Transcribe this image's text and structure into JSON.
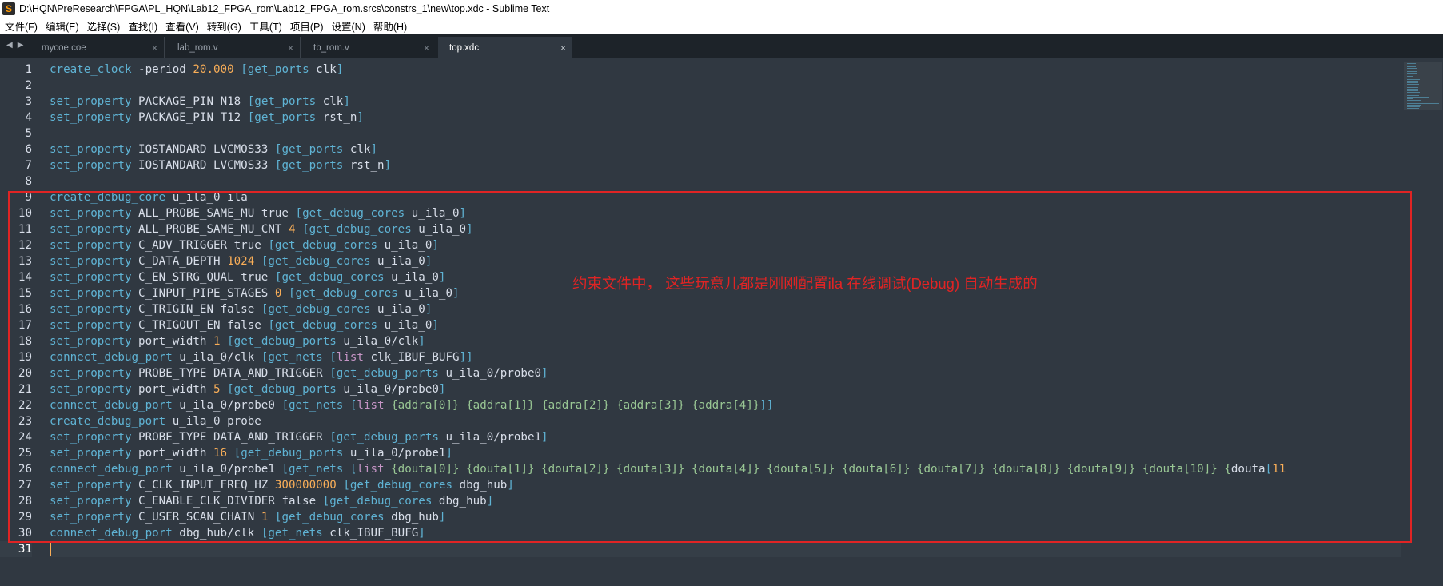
{
  "window": {
    "title": "D:\\HQN\\PreResearch\\FPGA\\PL_HQN\\Lab12_FPGA_rom\\Lab12_FPGA_rom.srcs\\constrs_1\\new\\top.xdc - Sublime Text",
    "app_icon_glyph": "S"
  },
  "menu": [
    "文件(F)",
    "编辑(E)",
    "选择(S)",
    "查找(I)",
    "查看(V)",
    "转到(G)",
    "工具(T)",
    "项目(P)",
    "设置(N)",
    "帮助(H)"
  ],
  "tabs": [
    {
      "label": "mycoe.coe",
      "active": false
    },
    {
      "label": "lab_rom.v",
      "active": false
    },
    {
      "label": "tb_rom.v",
      "active": false
    },
    {
      "label": "top.xdc",
      "active": true
    }
  ],
  "tab_close_glyph": "×",
  "nav": {
    "back": "◀",
    "forward": "▶"
  },
  "editor": {
    "current_line": 31,
    "lines": [
      "create_clock -period 20.000 [get_ports clk]",
      "",
      "set_property PACKAGE_PIN N18 [get_ports clk]",
      "set_property PACKAGE_PIN T12 [get_ports rst_n]",
      "",
      "set_property IOSTANDARD LVCMOS33 [get_ports clk]",
      "set_property IOSTANDARD LVCMOS33 [get_ports rst_n]",
      "",
      "create_debug_core u_ila_0 ila",
      "set_property ALL_PROBE_SAME_MU true [get_debug_cores u_ila_0]",
      "set_property ALL_PROBE_SAME_MU_CNT 4 [get_debug_cores u_ila_0]",
      "set_property C_ADV_TRIGGER true [get_debug_cores u_ila_0]",
      "set_property C_DATA_DEPTH 1024 [get_debug_cores u_ila_0]",
      "set_property C_EN_STRG_QUAL true [get_debug_cores u_ila_0]",
      "set_property C_INPUT_PIPE_STAGES 0 [get_debug_cores u_ila_0]",
      "set_property C_TRIGIN_EN false [get_debug_cores u_ila_0]",
      "set_property C_TRIGOUT_EN false [get_debug_cores u_ila_0]",
      "set_property port_width 1 [get_debug_ports u_ila_0/clk]",
      "connect_debug_port u_ila_0/clk [get_nets [list clk_IBUF_BUFG]]",
      "set_property PROBE_TYPE DATA_AND_TRIGGER [get_debug_ports u_ila_0/probe0]",
      "set_property port_width 5 [get_debug_ports u_ila_0/probe0]",
      "connect_debug_port u_ila_0/probe0 [get_nets [list {addra[0]} {addra[1]} {addra[2]} {addra[3]} {addra[4]}]]",
      "create_debug_port u_ila_0 probe",
      "set_property PROBE_TYPE DATA_AND_TRIGGER [get_debug_ports u_ila_0/probe1]",
      "set_property port_width 16 [get_debug_ports u_ila_0/probe1]",
      "connect_debug_port u_ila_0/probe1 [get_nets [list {douta[0]} {douta[1]} {douta[2]} {douta[3]} {douta[4]} {douta[5]} {douta[6]} {douta[7]} {douta[8]} {douta[9]} {douta[10]} {douta[11",
      "set_property C_CLK_INPUT_FREQ_HZ 300000000 [get_debug_cores dbg_hub]",
      "set_property C_ENABLE_CLK_DIVIDER false [get_debug_cores dbg_hub]",
      "set_property C_USER_SCAN_CHAIN 1 [get_debug_cores dbg_hub]",
      "connect_debug_port dbg_hub/clk [get_nets clk_IBUF_BUFG]",
      ""
    ]
  },
  "annotation": {
    "text": "约束文件中， 这些玩意儿都是刚刚配置ila 在线调试(Debug) 自动生成的",
    "color": "#e02424"
  },
  "colors": {
    "background": "#303841",
    "command": "#5fb3d4",
    "number": "#f9ae58",
    "keyword": "#c695c6",
    "brace_string": "#99c794",
    "text": "#d8dee9",
    "highlight_box": "#e02424"
  }
}
